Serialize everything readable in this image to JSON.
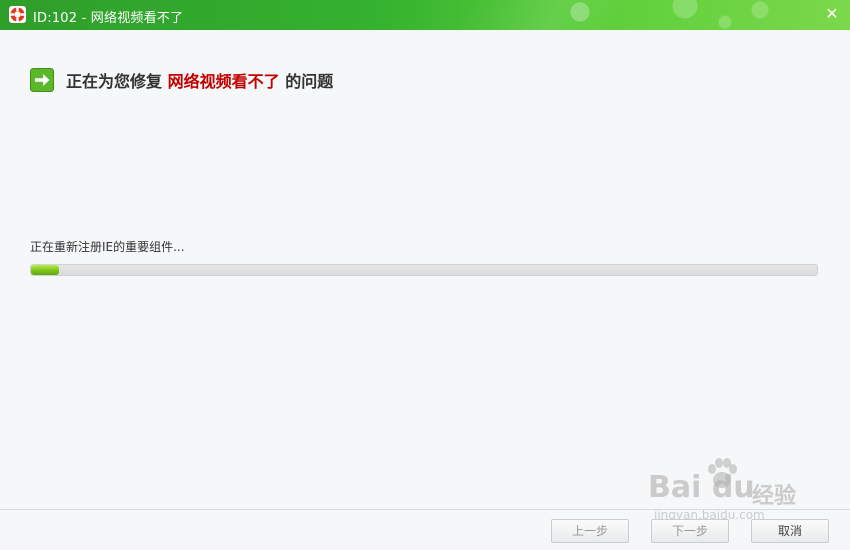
{
  "window": {
    "title": "ID:102 - 网络视频看不了",
    "close_glyph": "✕",
    "icon": "lifebuoy-icon"
  },
  "heading": {
    "prefix": "正在为您修复",
    "highlight": "网络视频看不了",
    "suffix": "的问题",
    "icon": "green-arrow-icon",
    "highlight_color": "#c20000"
  },
  "progress": {
    "status": "正在重新注册IE的重要组件...",
    "fraction": 0.035
  },
  "buttons": {
    "prev": "上一步",
    "next": "下一步",
    "cancel": "取消"
  },
  "watermark": {
    "logo": "Bai du",
    "sub": "经验",
    "url": "jingyan.baidu.com"
  },
  "colors": {
    "title_bar": "#35b22f",
    "progress_fill": "#7cc418"
  }
}
